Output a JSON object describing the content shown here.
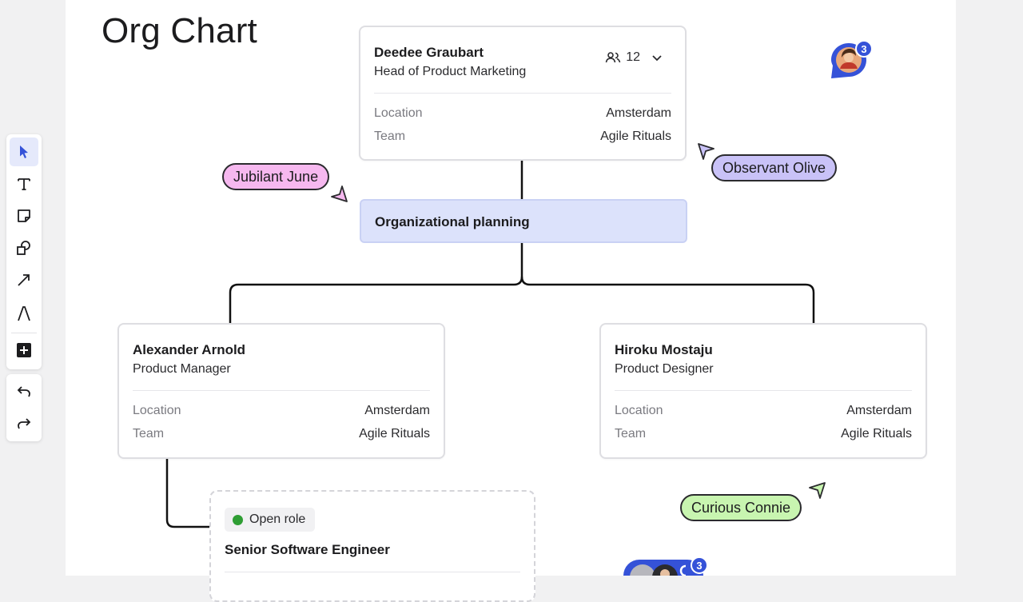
{
  "page": {
    "title": "Org Chart"
  },
  "head_card": {
    "name": "Deedee Graubart",
    "role": "Head of Product Marketing",
    "members_count": "12",
    "location_label": "Location",
    "location_value": "Amsterdam",
    "team_label": "Team",
    "team_value": "Agile Rituals"
  },
  "planning": {
    "label": "Organizational planning"
  },
  "left_card": {
    "name": "Alexander Arnold",
    "role": "Product Manager",
    "location_label": "Location",
    "location_value": "Amsterdam",
    "team_label": "Team",
    "team_value": "Agile Rituals"
  },
  "right_card": {
    "name": "Hiroku Mostaju",
    "role": "Product Designer",
    "location_label": "Location",
    "location_value": "Amsterdam",
    "team_label": "Team",
    "team_value": "Agile Rituals"
  },
  "open_role_card": {
    "badge": "Open role",
    "title": "Senior Software Engineer"
  },
  "cursors": {
    "june": {
      "name": "Jubilant June",
      "color": "#f6b8ef"
    },
    "olive": {
      "name": "Observant Olive",
      "color": "#c9c2f7"
    },
    "connie": {
      "name": "Curious Connie",
      "color": "#c8f5b0"
    }
  },
  "comments": {
    "top_count": "3",
    "bottom_count": "3",
    "accent": "#3552d8"
  },
  "toolbar": {
    "tools": [
      "select-icon",
      "text-icon",
      "sticky-note-icon",
      "shapes-icon",
      "arrow-icon",
      "pen-icon",
      "add-icon"
    ],
    "history": [
      "undo-icon",
      "redo-icon"
    ]
  }
}
